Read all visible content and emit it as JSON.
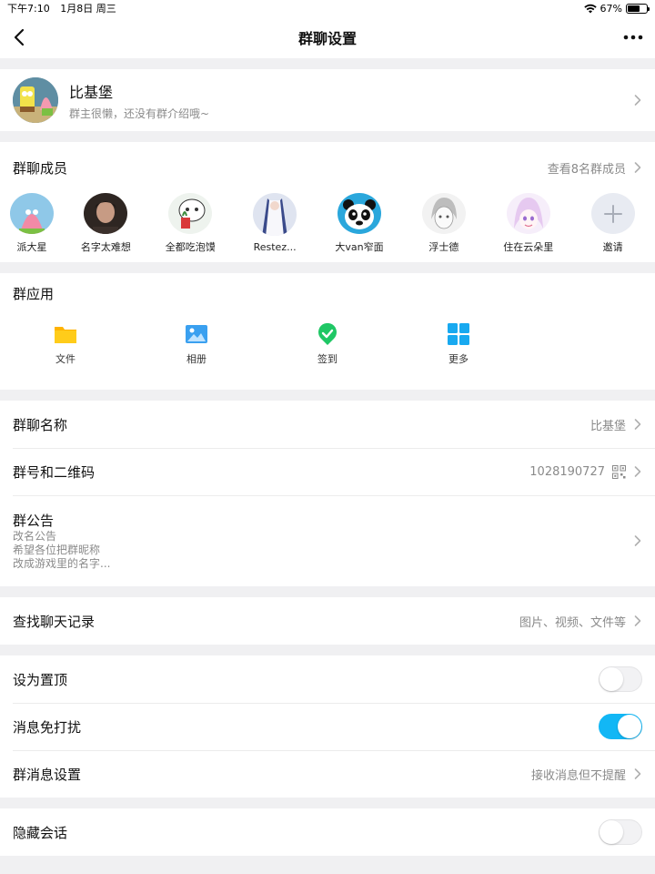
{
  "status_bar": {
    "time": "下午7:10",
    "date": "1月8日 周三",
    "battery": "67%",
    "battery_level": 0.67
  },
  "nav": {
    "title": "群聊设置"
  },
  "group": {
    "name": "比基堡",
    "description": "群主很懒，还没有群介绍哦~"
  },
  "members": {
    "title": "群聊成员",
    "view_all": "查看8名群成员",
    "items": [
      {
        "name": "派大星"
      },
      {
        "name": "名字太难想"
      },
      {
        "name": "全都吃泡馍"
      },
      {
        "name": "Restez..."
      },
      {
        "name": "大van窄面"
      },
      {
        "name": "浮士德"
      },
      {
        "name": "住在云朵里"
      },
      {
        "name": "邀请"
      }
    ]
  },
  "apps": {
    "title": "群应用",
    "items": [
      {
        "label": "文件",
        "icon": "folder-icon"
      },
      {
        "label": "相册",
        "icon": "photo-album-icon"
      },
      {
        "label": "签到",
        "icon": "checkin-icon"
      },
      {
        "label": "更多",
        "icon": "grid-more-icon"
      }
    ]
  },
  "info": {
    "name_label": "群聊名称",
    "name_value": "比基堡",
    "id_label": "群号和二维码",
    "id_value": "1028190727",
    "notice_label": "群公告",
    "notice_lines": [
      "改名公告",
      "希望各位把群昵称",
      "改成游戏里的名字..."
    ]
  },
  "search": {
    "label": "查找聊天记录",
    "hint": "图片、视频、文件等"
  },
  "settings": {
    "pin_label": "设为置顶",
    "pin_on": false,
    "dnd_label": "消息免打扰",
    "dnd_on": true,
    "msg_label": "群消息设置",
    "msg_value": "接收消息但不提醒"
  },
  "hide": {
    "label": "隐藏会话",
    "on": false
  },
  "colors": {
    "accent": "#12b7f5",
    "secondary_text": "#8a8a8a",
    "background": "#f0f0f2"
  }
}
